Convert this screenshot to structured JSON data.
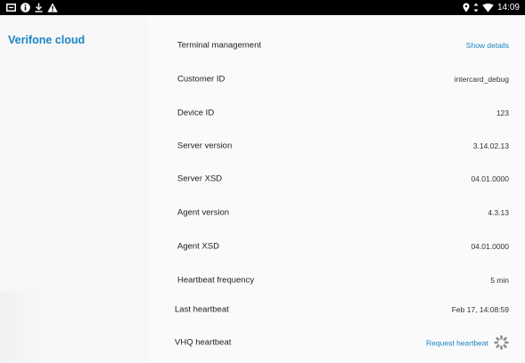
{
  "status_bar": {
    "time": "14:09",
    "icons_left": [
      "notification-box-icon",
      "info-icon",
      "download-icon",
      "warning-icon"
    ],
    "icons_right": [
      "location-icon",
      "data-transfer-icon",
      "wifi-icon"
    ]
  },
  "sidebar": {
    "title": "Verifone cloud"
  },
  "rows": [
    {
      "label": "Terminal management",
      "value": "Show details"
    },
    {
      "label": "Customer ID",
      "value": "intercard_debug"
    },
    {
      "label": "Device ID",
      "value": "123"
    },
    {
      "label": "Server version",
      "value": "3.14.02.13"
    },
    {
      "label": "Server XSD",
      "value": "04.01.0000"
    },
    {
      "label": "Agent version",
      "value": "4.3.13"
    },
    {
      "label": "Agent XSD",
      "value": "04.01.0000"
    },
    {
      "label": "Heartbeat frequency",
      "value": "5 min"
    },
    {
      "label": "Last heartbeat",
      "value": "Feb 17, 14:08:59"
    },
    {
      "label": "VHQ heartbeat",
      "value": "Request heartbeat"
    }
  ],
  "colors": {
    "accent": "#1b84c4",
    "status_bar": "#000000",
    "background": "#fafafa"
  }
}
